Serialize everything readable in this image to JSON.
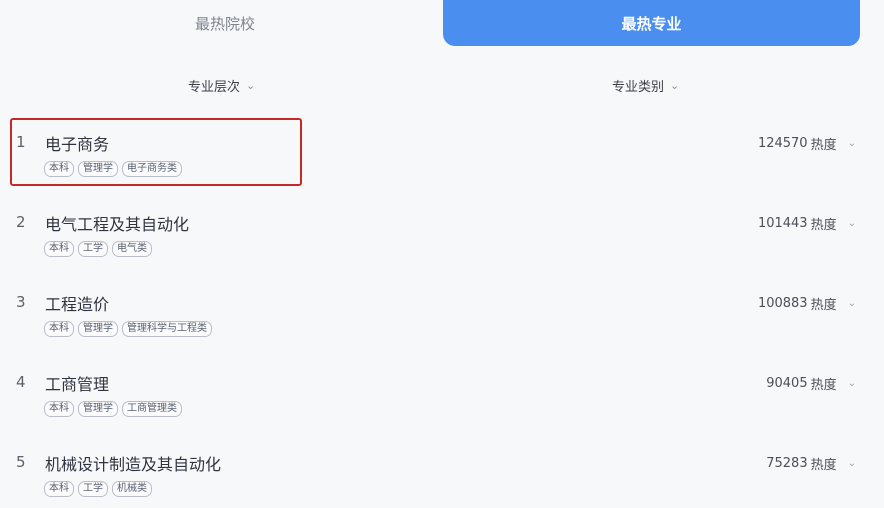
{
  "tabs": [
    {
      "label": "最热院校",
      "active": false
    },
    {
      "label": "最热专业",
      "active": true
    }
  ],
  "filters": [
    {
      "label": "专业层次",
      "icon": "chevron-down-icon"
    },
    {
      "label": "专业类别",
      "icon": "chevron-down-icon"
    }
  ],
  "colors": {
    "accent": "#4a8ef0",
    "highlight_border": "#c62828"
  },
  "majors": [
    {
      "index": "1",
      "name": "电子商务",
      "tags": [
        "本科",
        "管理学",
        "电子商务类"
      ],
      "heat_value": "124570",
      "heat_unit": "热度"
    },
    {
      "index": "2",
      "name": "电气工程及其自动化",
      "tags": [
        "本科",
        "工学",
        "电气类"
      ],
      "heat_value": "101443",
      "heat_unit": "热度"
    },
    {
      "index": "3",
      "name": "工程造价",
      "tags": [
        "本科",
        "管理学",
        "管理科学与工程类"
      ],
      "heat_value": "100883",
      "heat_unit": "热度"
    },
    {
      "index": "4",
      "name": "工商管理",
      "tags": [
        "本科",
        "管理学",
        "工商管理类"
      ],
      "heat_value": "90405",
      "heat_unit": "热度"
    },
    {
      "index": "5",
      "name": "机械设计制造及其自动化",
      "tags": [
        "本科",
        "工学",
        "机械类"
      ],
      "heat_value": "75283",
      "heat_unit": "热度"
    }
  ]
}
